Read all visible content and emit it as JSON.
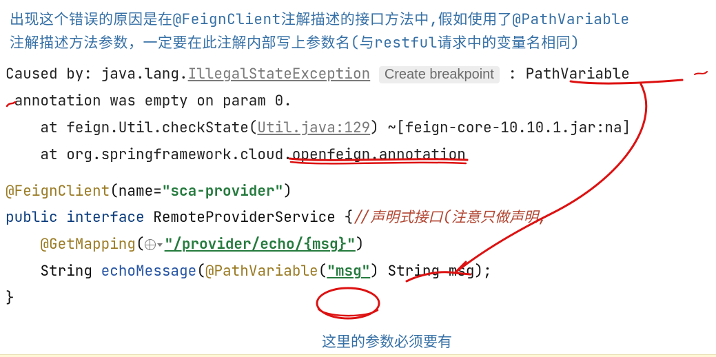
{
  "title": {
    "line1": "出现这个错误的原因是在@FeignClient注解描述的接口方法中,假如使用了@PathVariable",
    "line2": "注解描述方法参数，一定要在此注解内部写上参数名(与restful请求中的变量名相同)"
  },
  "stacktrace": {
    "caused_by": "Caused by: java.lang.",
    "exception": "IllegalStateException",
    "breakpoint_label": "Create breakpoint",
    "colon_sp": " : ",
    "path_var": "PathVariable",
    "line2_prefix": " annotation was empty on param 0.",
    "at1_prefix": "    at feign.Util.checkState(",
    "at1_link": "Util.java:129",
    "at1_suffix": ") ~[feign-core-10.10.1.jar:na]",
    "at2": "    at org.springframework.cloud.openfeign.annotation"
  },
  "code": {
    "anno_feign": "@FeignClient",
    "feign_args_open": "(name=",
    "feign_name": "\"sca-provider\"",
    "feign_args_close": ")",
    "kw_public": "public",
    "kw_interface": "interface",
    "iface_name": "RemoteProviderService",
    "brace_open": "{",
    "comment": "//声明式接口(注意只做声明,",
    "anno_get": "@GetMapping",
    "get_open": "(",
    "get_path": "\"/provider/echo/{msg}\"",
    "get_close": ")",
    "ret_type": "String",
    "method_name": "echoMessage",
    "method_open": "(",
    "anno_path": "@PathVariable",
    "pv_open": "(",
    "pv_val": "\"msg\"",
    "pv_close": ")",
    "param_type": "String",
    "param_name": "msg",
    "method_close": ");",
    "brace_close": "}"
  },
  "note": {
    "param_must": "这里的参数必须要有"
  }
}
